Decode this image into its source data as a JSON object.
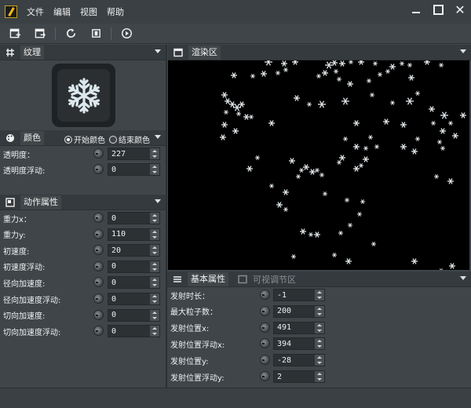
{
  "menu": {
    "file": "文件",
    "edit": "编辑",
    "view": "视图",
    "help": "帮助"
  },
  "window": {
    "close_glyph": "✕"
  },
  "texture_panel": {
    "title": "纹理"
  },
  "color_panel": {
    "title": "颜色",
    "start_color": "开始颜色",
    "end_color": "结束颜色",
    "selected": "开始颜色",
    "props": [
      {
        "label": "透明度：",
        "value": "227"
      },
      {
        "label": "透明度浮动:",
        "value": "0"
      }
    ]
  },
  "motion_panel": {
    "title": "动作属性",
    "props": [
      {
        "label": "重力x：",
        "value": "0"
      },
      {
        "label": "重力y:",
        "value": "110"
      },
      {
        "label": "初速度:",
        "value": "20"
      },
      {
        "label": "初速度浮动:",
        "value": "0"
      },
      {
        "label": "径向加速度:",
        "value": "0"
      },
      {
        "label": "径向加速度浮动:",
        "value": "0"
      },
      {
        "label": "切向加速度:",
        "value": "0"
      },
      {
        "label": "切向加速度浮动:",
        "value": "0"
      }
    ]
  },
  "render_panel": {
    "title": "渲染区"
  },
  "basic_panel": {
    "tab_basic": "基本属性",
    "tab_visual": "可视调节区",
    "props": [
      {
        "label": "发射时长：",
        "value": "-1"
      },
      {
        "label": "最大粒子数：",
        "value": "200"
      },
      {
        "label": "发射位置x:",
        "value": "491"
      },
      {
        "label": "发射位置浮动x:",
        "value": "394"
      },
      {
        "label": "发射位置y:",
        "value": "-28"
      },
      {
        "label": "发射位置浮动y:",
        "value": "2"
      }
    ]
  },
  "colors": {
    "accent": "#3f4549",
    "render_bg": "#000000",
    "snow": "#dfe6ea"
  },
  "icons": {
    "toolbar": [
      "new-file-icon",
      "export-file-icon",
      "refresh-icon",
      "fit-icon",
      "play-icon"
    ]
  }
}
